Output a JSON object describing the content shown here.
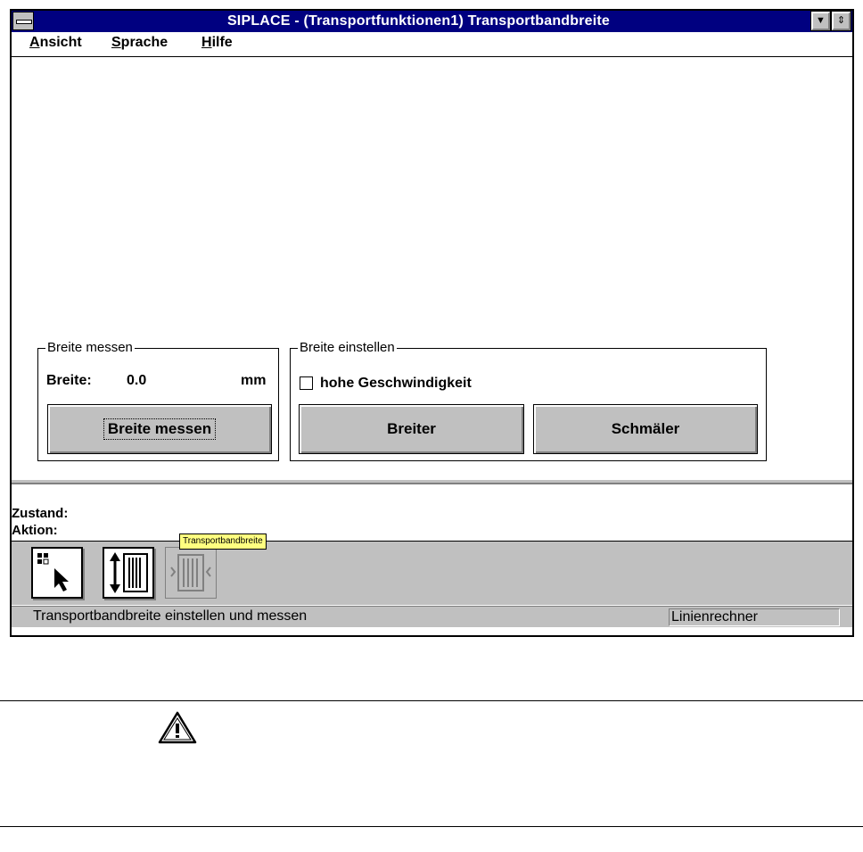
{
  "window": {
    "title": "SIPLACE - (Transportfunktionen1) Transportbandbreite"
  },
  "menu": {
    "items": [
      "Ansicht",
      "Sprache",
      "Hilfe"
    ]
  },
  "measure_group": {
    "caption": "Breite messen",
    "width_label": "Breite:",
    "width_value": "0.0",
    "unit": "mm",
    "button": "Breite messen"
  },
  "adjust_group": {
    "caption": "Breite einstellen",
    "checkbox_label": "hohe Geschwindigkeit",
    "checkbox_checked": false,
    "wider_button": "Breiter",
    "narrower_button": "Schmäler"
  },
  "status": {
    "state_label": "Zustand:",
    "action_label": "Aktion:"
  },
  "toolbar": {
    "tools": [
      "select-pointer-icon",
      "transport-adjust-icon",
      "transport-width-icon"
    ],
    "tooltip": "Transportbandbreite"
  },
  "statusbar": {
    "message": "Transportbandbreite einstellen und messen",
    "computer": "Linienrechner"
  },
  "note": {
    "icon": "warning-icon"
  }
}
